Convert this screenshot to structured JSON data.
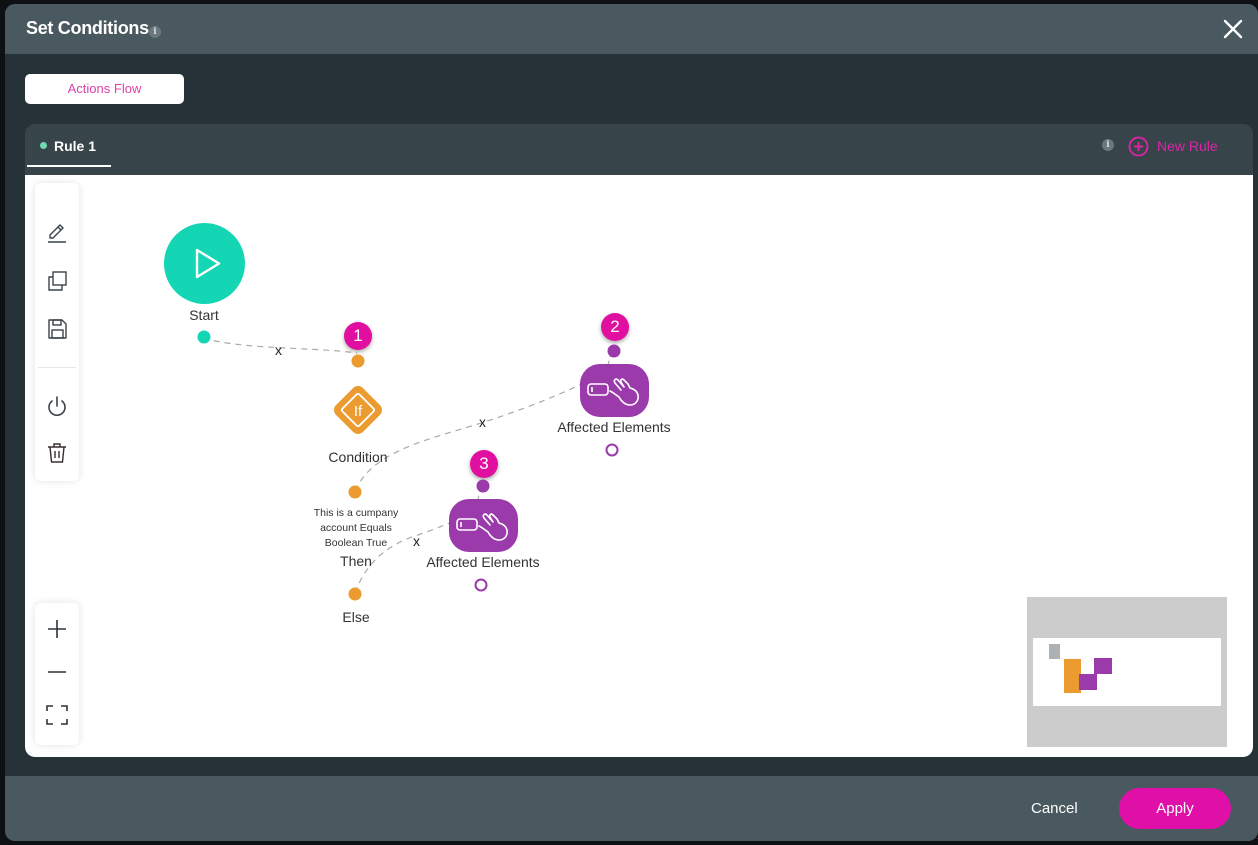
{
  "modal": {
    "title": "Set Conditions",
    "info_icon": "info-icon",
    "close_icon": "close-icon"
  },
  "tabs": [
    {
      "label": "Actions Flow",
      "active": true
    }
  ],
  "rules": {
    "active_rule": "Rule 1",
    "active_rule_status_color": "#6fd9b0",
    "new_rule_label": "New Rule",
    "new_rule_icon": "plus-circle-icon"
  },
  "toolbar": {
    "tools": [
      {
        "name": "edit",
        "icon": "pencil-icon"
      },
      {
        "name": "duplicate",
        "icon": "copy-icon"
      },
      {
        "name": "save",
        "icon": "save-icon"
      },
      {
        "name": "toggle",
        "icon": "power-icon"
      },
      {
        "name": "delete",
        "icon": "trash-icon"
      }
    ],
    "zoom": [
      {
        "name": "zoom-in",
        "icon": "plus-icon"
      },
      {
        "name": "zoom-out",
        "icon": "minus-icon"
      },
      {
        "name": "fit",
        "icon": "fit-screen-icon"
      }
    ]
  },
  "flow": {
    "nodes": [
      {
        "id": "start",
        "type": "start",
        "label": "Start",
        "color": "#14d5b4"
      },
      {
        "id": "condition",
        "type": "condition",
        "label": "Condition",
        "badge": "1",
        "color": "#eb9b30",
        "outputs": [
          {
            "label": "Then",
            "description": "This is a cumpany account Equals Boolean True"
          },
          {
            "label": "Else"
          }
        ]
      },
      {
        "id": "affected-1",
        "type": "action",
        "label": "Affected Elements",
        "badge": "2",
        "color": "#9b3bab"
      },
      {
        "id": "affected-2",
        "type": "action",
        "label": "Affected Elements",
        "badge": "3",
        "color": "#9b3bab"
      }
    ],
    "edges": [
      {
        "from": "start",
        "to": "condition",
        "remove_label": "x"
      },
      {
        "from": "condition.then",
        "to": "affected-1",
        "remove_label": "x"
      },
      {
        "from": "condition.else",
        "to": "affected-2",
        "remove_label": "x"
      }
    ]
  },
  "footer": {
    "cancel_label": "Cancel",
    "apply_label": "Apply",
    "accent_color": "#e00fa8"
  }
}
